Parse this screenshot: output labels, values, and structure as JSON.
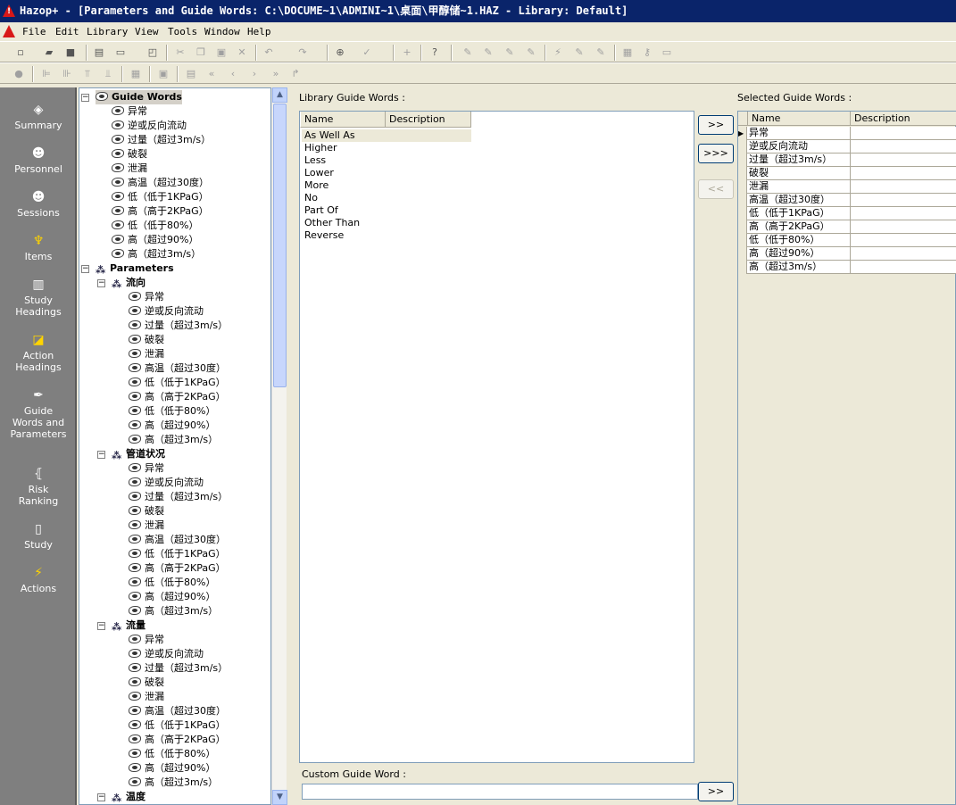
{
  "window": {
    "title": "Hazop+ - [Parameters and Guide Words: C:\\DOCUME~1\\ADMINI~1\\桌面\\甲醇储~1.HAZ - Library: Default]"
  },
  "menu": [
    "File",
    "Edit",
    "Library",
    "View",
    "Tools",
    "Window",
    "Help"
  ],
  "nav": [
    {
      "label": "Summary",
      "icon": "summary-icon"
    },
    {
      "label": "Personnel",
      "icon": "personnel-icon"
    },
    {
      "label": "Sessions",
      "icon": "sessions-icon"
    },
    {
      "label": "Items",
      "icon": "items-icon"
    },
    {
      "label": "Study\nHeadings",
      "icon": "study-headings-icon"
    },
    {
      "label": "Action\nHeadings",
      "icon": "action-headings-icon"
    },
    {
      "label": "Guide\nWords and\nParameters",
      "icon": "guide-words-icon"
    },
    {
      "label": "Risk\nRanking",
      "icon": "risk-ranking-icon"
    },
    {
      "label": "Study",
      "icon": "study-icon"
    },
    {
      "label": "Actions",
      "icon": "actions-icon"
    }
  ],
  "tree": {
    "guide_words_root": "Guide Words",
    "parameters_root": "Parameters",
    "words": [
      "异常",
      "逆或反向流动",
      "过量（超过3m/s）",
      "破裂",
      "泄漏",
      "高温（超过30度）",
      "低（低于1KPaG）",
      "高（高于2KPaG）",
      "低（低于80%）",
      "高（超过90%）",
      "高（超过3m/s）"
    ],
    "parameters": [
      {
        "name": "流向",
        "words": [
          "异常",
          "逆或反向流动",
          "过量（超过3m/s）",
          "破裂",
          "泄漏",
          "高温（超过30度）",
          "低（低于1KPaG）",
          "高（高于2KPaG）",
          "低（低于80%）",
          "高（超过90%）",
          "高（超过3m/s）"
        ]
      },
      {
        "name": "管道状况",
        "words": [
          "异常",
          "逆或反向流动",
          "过量（超过3m/s）",
          "破裂",
          "泄漏",
          "高温（超过30度）",
          "低（低于1KPaG）",
          "高（高于2KPaG）",
          "低（低于80%）",
          "高（超过90%）",
          "高（超过3m/s）"
        ]
      },
      {
        "name": "流量",
        "words": [
          "异常",
          "逆或反向流动",
          "过量（超过3m/s）",
          "破裂",
          "泄漏",
          "高温（超过30度）",
          "低（低于1KPaG）",
          "高（高于2KPaG）",
          "低（低于80%）",
          "高（超过90%）",
          "高（超过3m/s）"
        ]
      },
      {
        "name": "温度",
        "words": []
      }
    ]
  },
  "library": {
    "label": "Library Guide Words :",
    "columns": [
      "Name",
      "Description"
    ],
    "rows": [
      "As Well As",
      "Higher",
      "Less",
      "Lower",
      "More",
      "No",
      "Part Of",
      "Other Than",
      "Reverse"
    ]
  },
  "selected": {
    "label": "Selected Guide Words :",
    "columns": [
      "Name",
      "Description"
    ],
    "rows": [
      "异常",
      "逆或反向流动",
      "过量（超过3m/s）",
      "破裂",
      "泄漏",
      "高温（超过30度）",
      "低（低于1KPaG）",
      "高（高于2KPaG）",
      "低（低于80%）",
      "高（超过90%）",
      "高（超过3m/s）"
    ]
  },
  "buttons": {
    "add": ">>",
    "add_all": ">>>",
    "remove": "<<",
    "add_custom": ">>"
  },
  "custom": {
    "label": "Custom Guide Word :",
    "value": ""
  }
}
